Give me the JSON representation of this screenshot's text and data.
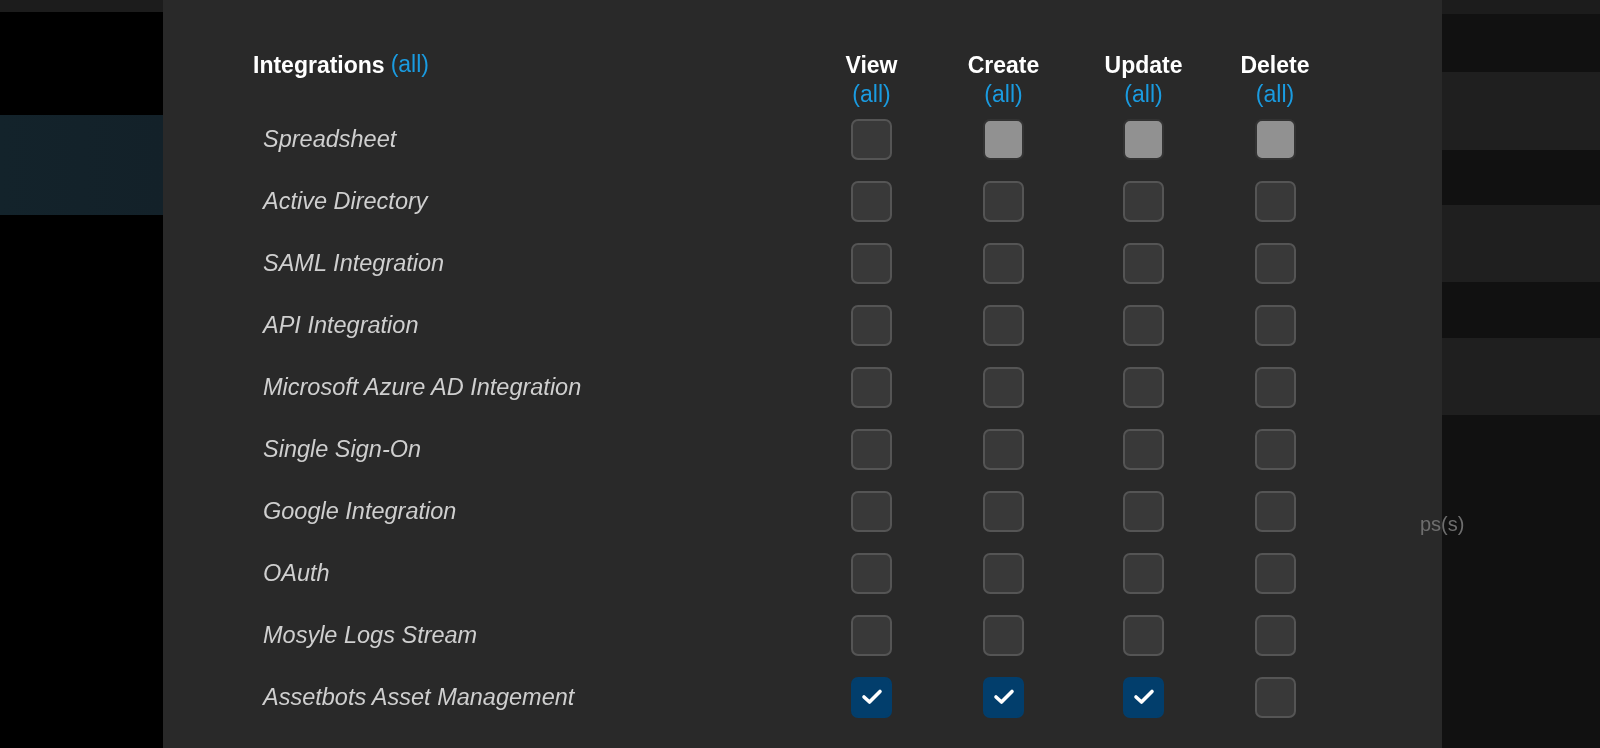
{
  "permissions": {
    "title": "Integrations",
    "title_link": "(all)",
    "columns": [
      {
        "label": "View",
        "link": "(all)"
      },
      {
        "label": "Create",
        "link": "(all)"
      },
      {
        "label": "Update",
        "link": "(all)"
      },
      {
        "label": "Delete",
        "link": "(all)"
      }
    ],
    "rows": [
      {
        "label": "Spreadsheet",
        "cells": [
          {
            "checked": false,
            "disabled": false
          },
          {
            "checked": false,
            "disabled": true
          },
          {
            "checked": false,
            "disabled": true
          },
          {
            "checked": false,
            "disabled": true
          }
        ]
      },
      {
        "label": "Active Directory",
        "cells": [
          {
            "checked": false,
            "disabled": false
          },
          {
            "checked": false,
            "disabled": false
          },
          {
            "checked": false,
            "disabled": false
          },
          {
            "checked": false,
            "disabled": false
          }
        ]
      },
      {
        "label": "SAML Integration",
        "cells": [
          {
            "checked": false,
            "disabled": false
          },
          {
            "checked": false,
            "disabled": false
          },
          {
            "checked": false,
            "disabled": false
          },
          {
            "checked": false,
            "disabled": false
          }
        ]
      },
      {
        "label": "API Integration",
        "cells": [
          {
            "checked": false,
            "disabled": false
          },
          {
            "checked": false,
            "disabled": false
          },
          {
            "checked": false,
            "disabled": false
          },
          {
            "checked": false,
            "disabled": false
          }
        ]
      },
      {
        "label": "Microsoft Azure AD Integration",
        "cells": [
          {
            "checked": false,
            "disabled": false
          },
          {
            "checked": false,
            "disabled": false
          },
          {
            "checked": false,
            "disabled": false
          },
          {
            "checked": false,
            "disabled": false
          }
        ]
      },
      {
        "label": "Single Sign-On",
        "cells": [
          {
            "checked": false,
            "disabled": false
          },
          {
            "checked": false,
            "disabled": false
          },
          {
            "checked": false,
            "disabled": false
          },
          {
            "checked": false,
            "disabled": false
          }
        ]
      },
      {
        "label": "Google Integration",
        "cells": [
          {
            "checked": false,
            "disabled": false
          },
          {
            "checked": false,
            "disabled": false
          },
          {
            "checked": false,
            "disabled": false
          },
          {
            "checked": false,
            "disabled": false
          }
        ]
      },
      {
        "label": "OAuth",
        "cells": [
          {
            "checked": false,
            "disabled": false
          },
          {
            "checked": false,
            "disabled": false
          },
          {
            "checked": false,
            "disabled": false
          },
          {
            "checked": false,
            "disabled": false
          }
        ]
      },
      {
        "label": "Mosyle Logs Stream",
        "cells": [
          {
            "checked": false,
            "disabled": false
          },
          {
            "checked": false,
            "disabled": false
          },
          {
            "checked": false,
            "disabled": false
          },
          {
            "checked": false,
            "disabled": false
          }
        ]
      },
      {
        "label": "Assetbots Asset Management",
        "cells": [
          {
            "checked": true,
            "disabled": false
          },
          {
            "checked": true,
            "disabled": false
          },
          {
            "checked": true,
            "disabled": false
          },
          {
            "checked": false,
            "disabled": false
          }
        ]
      }
    ]
  },
  "background": {
    "text": "ps(s)"
  }
}
